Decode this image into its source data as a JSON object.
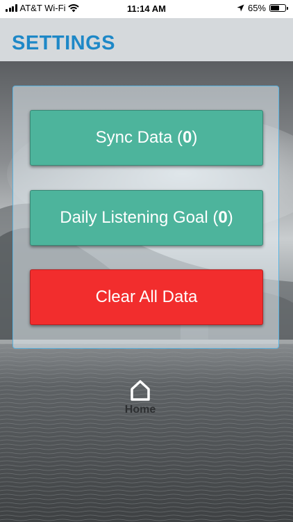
{
  "status_bar": {
    "carrier": "AT&T Wi-Fi",
    "time": "11:14 AM",
    "battery_percent": "65%",
    "battery_level": 0.65,
    "icons": [
      "signal-icon",
      "wifi-icon",
      "location-arrow-icon",
      "battery-icon"
    ]
  },
  "header": {
    "title": "SETTINGS",
    "title_color": "#1e88c7",
    "background": "#d5d9dc"
  },
  "buttons": {
    "sync": {
      "label": "Sync Data (",
      "count": "0",
      "suffix": ")",
      "color": "#4db49c"
    },
    "goal": {
      "label": "Daily Listening Goal (",
      "count": "0",
      "suffix": ")",
      "color": "#4db49c"
    },
    "clear": {
      "label": "Clear All Data",
      "color": "#f22d2d"
    }
  },
  "nav": {
    "home_label": "Home",
    "home_icon": "home-icon"
  },
  "panel_border_color": "#5ab4e2"
}
